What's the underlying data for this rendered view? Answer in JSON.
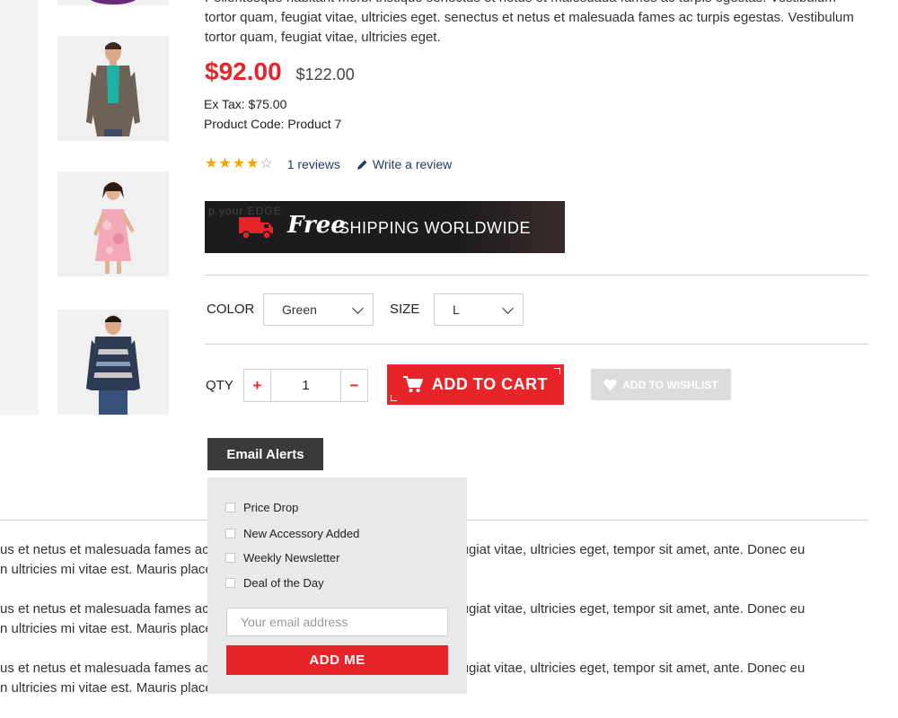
{
  "description_top": "Pellentesque habitant morbi tristique senectus et netus et malesuada fames ac turpis egestas. Vestibulum tortor quam, feugiat vitae, ultricies eget. senectus et netus et malesuada fames ac turpis egestas. Vestibulum tortor quam, feugiat vitae, ultricies eget.",
  "product": {
    "price_new": "$92.00",
    "price_old": "$122.00",
    "ex_tax": "Ex Tax: $75.00",
    "product_code": "Product Code: Product 7",
    "rating": 4,
    "rating_max": 5,
    "reviews_link": "1 reviews",
    "write_review_link": "Write a review"
  },
  "banner": {
    "faint_text": "p your EDGE",
    "free_text": "Free",
    "shipping_text": "SHIPPING WORLDWIDE"
  },
  "options": {
    "color_label": "COLOR",
    "color_value": "Green",
    "size_label": "SIZE",
    "size_value": "L"
  },
  "cart": {
    "qty_label": "QTY",
    "qty_value": "1",
    "plus_symbol": "+",
    "minus_symbol": "−",
    "add_to_cart": "ADD TO CART",
    "add_to_wishlist": "ADD TO WISHLIST"
  },
  "email_alerts": {
    "tab_label": "Email Alerts",
    "items": [
      "Price Drop",
      "New Accessory Added",
      "Weekly Newsletter",
      "Deal of the Day"
    ],
    "email_placeholder": "Your email address",
    "submit_label": "ADD ME"
  },
  "paragraphs": [
    {
      "line1": "us et netus et malesuada fames ac turpis egestas. Vestibulum tortor quam, feugiat vitae, ultricies eget, tempor sit amet, ante. Donec eu",
      "line2": "n ultricies mi vitae est. Mauris placerat eleifend leo."
    },
    {
      "line1": "us et netus et malesuada fames ac turpis egestas. Vestibulum tortor quam, feugiat vitae, ultricies eget, tempor sit amet, ante. Donec eu",
      "line2": "n ultricies mi vitae est. Mauris placerat eleifend leo."
    },
    {
      "line1": "us et netus et malesuada fames ac turpis egestas. Vestibulum tortor quam, feugiat vitae, ultricies eget, tempor sit amet, ante. Donec eu",
      "line2": "n ultricies mi vitae est. Mauris placerat eleifend leo."
    }
  ],
  "colors": {
    "accent": "#e8242b",
    "dark_tab": "#3a3a3a",
    "link": "#1f3b5e",
    "star": "#f0a500",
    "panel_bg": "#e9e9e9"
  },
  "icons": {
    "cart": "shopping-cart-icon",
    "heart": "heart-icon",
    "pencil": "pencil-icon",
    "truck": "truck-icon",
    "chevron": "chevron-down-icon"
  }
}
